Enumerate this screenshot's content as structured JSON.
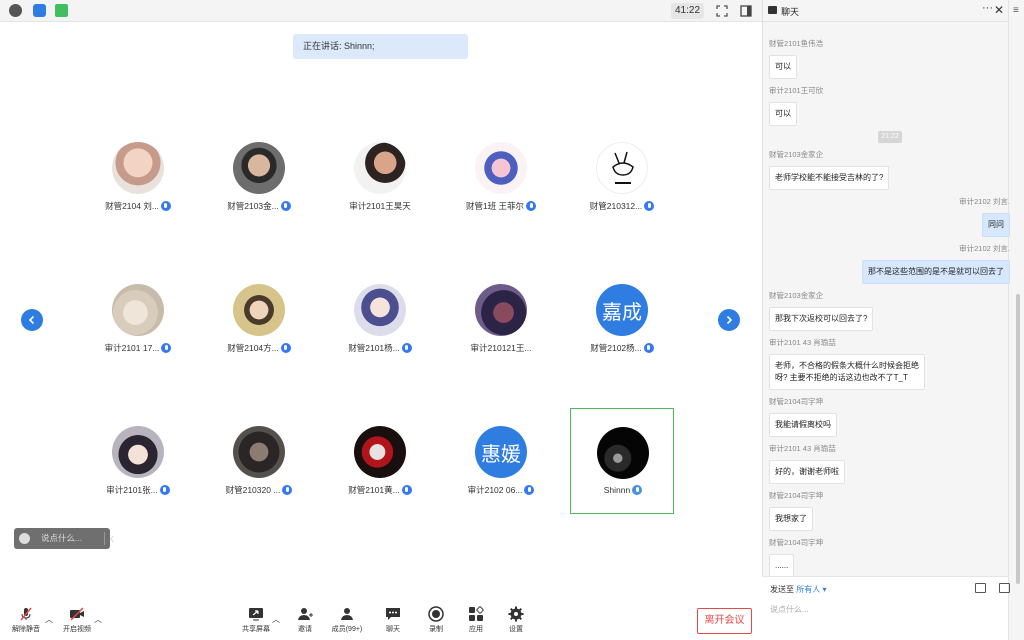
{
  "timer": "41:22",
  "speaking_banner": "正在讲话: Shinnn;",
  "participants": [
    {
      "name": "财管2104 刘..."
    },
    {
      "name": "财管2103金..."
    },
    {
      "name": "审计2101王昊天"
    },
    {
      "name": "财管1班 王菲尔"
    },
    {
      "name": "财管210312..."
    },
    {
      "name": "审计2101 17..."
    },
    {
      "name": "财管2104方..."
    },
    {
      "name": "财管2101杨..."
    },
    {
      "name": "审计210121王..."
    },
    {
      "name": "财管2102杨...",
      "avatar_text": "嘉成"
    },
    {
      "name": "审计2101张..."
    },
    {
      "name": "财管210320 ..."
    },
    {
      "name": "财管2101黄..."
    },
    {
      "name": "审计2102 06...",
      "avatar_text": "惠媛"
    },
    {
      "name": "Shinnn"
    }
  ],
  "quick_chat_placeholder": "说点什么...",
  "toolbar": {
    "unmute": "解除静音",
    "start_video": "开启视频",
    "share_screen": "共享屏幕",
    "invite": "邀请",
    "members": "成员(99+)",
    "chat": "聊天",
    "record": "录制",
    "apps": "应用",
    "settings": "设置",
    "leave": "离开会议"
  },
  "chat": {
    "title": "聊天",
    "time_chip": "21:22",
    "messages": [
      {
        "sender": "财管2101鱼伟浩",
        "text": "可以",
        "side": "left"
      },
      {
        "sender": "审计2101王可欣",
        "text": "可以",
        "side": "left"
      },
      {
        "sender": "财管2103金家企",
        "text": "老师学校能不能接受吉林的了?",
        "side": "left"
      },
      {
        "sender": "审计2102 刘言.",
        "text": "同问",
        "side": "right"
      },
      {
        "sender": "审计2102 刘言.",
        "text": "那不是这些范围的是不是就可以回去了",
        "side": "right"
      },
      {
        "sender": "财管2103金家企",
        "text": "那我下次返校可以回去了?",
        "side": "left"
      },
      {
        "sender": "审计2101 43 肖瑜喆",
        "text": "老师，不合格的假条大概什么时候会拒绝\n呀? 主要不拒绝的话这边也改不了T_T",
        "side": "left"
      },
      {
        "sender": "财管2104司宇坤",
        "text": "我能请假离校吗",
        "side": "left"
      },
      {
        "sender": "审计2101 43 肖瑜喆",
        "text": "好的，谢谢老师啦",
        "side": "left"
      },
      {
        "sender": "财管2104司宇坤",
        "text": "我想家了",
        "side": "left"
      },
      {
        "sender": "财管2104司宇坤",
        "text": "......",
        "side": "left"
      }
    ],
    "send_to_label": "发送至",
    "send_to_target": "所有人",
    "input_placeholder": "说点什么..."
  }
}
